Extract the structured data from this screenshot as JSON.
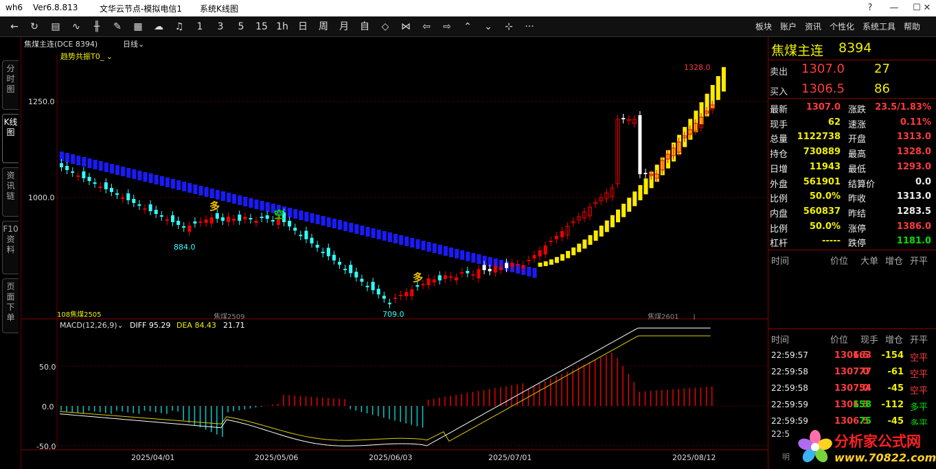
{
  "titlebar": {
    "app": "wh6",
    "version": "Ver6.8.813",
    "server": "文华云节点-模拟电信1",
    "view": "系统K线图"
  },
  "window_buttons": {
    "help": "?",
    "minimize": "—",
    "maximize": "☐",
    "close": "✕"
  },
  "toolbar": {
    "periods": [
      "1",
      "3",
      "5",
      "15",
      "1h",
      "日",
      "周",
      "月",
      "自"
    ],
    "menus": [
      "板块",
      "账户",
      "资讯",
      "个性化",
      "系统工具",
      "帮助"
    ],
    "more": "···"
  },
  "side_tabs": [
    "分时图",
    "K线图",
    "资讯链",
    "F10资料",
    "页面下单"
  ],
  "chart_header": {
    "symbol": "焦煤主连(DCE 8394)",
    "period": "日线",
    "indicator": "趋势共振T0_"
  },
  "price_axis": {
    "labels": [
      "1250.0",
      "1000.0"
    ]
  },
  "annotations": {
    "high": "1328.0",
    "low1": "884.0",
    "low2": "709.0",
    "contract1": "焦煤2509",
    "contract2": "焦煤2601",
    "contract0": "108焦煤2505",
    "duo": "多",
    "kong": "空"
  },
  "macd": {
    "title": "MACD(12,26,9)",
    "diff": "DIFF 95.29",
    "dea": "DEA 84.43",
    "macd": "21.71",
    "axis": [
      "50.0",
      "0.0",
      "-50.0"
    ]
  },
  "dates": [
    "2025/04/01",
    "2025/05/06",
    "2025/06/03",
    "2025/07/01",
    "2025/08/12"
  ],
  "quote": {
    "name": "焦煤主连",
    "code": "8394",
    "sell": {
      "label": "卖出",
      "price": "1307.0",
      "vol": "27"
    },
    "buy": {
      "label": "买入",
      "price": "1306.5",
      "vol": "86"
    },
    "rows": [
      [
        "最新",
        "1307.0",
        "涨跌",
        "23.5/1.83%"
      ],
      [
        "现手",
        "62",
        "速涨",
        "0.11%"
      ],
      [
        "总量",
        "1122738",
        "开盘",
        "1313.0"
      ],
      [
        "持仓",
        "730889",
        "最高",
        "1328.0"
      ],
      [
        "日增",
        "11943",
        "最低",
        "1293.0"
      ],
      [
        "外盘",
        "561901",
        "结算价",
        "0.0"
      ],
      [
        "比例",
        "50.0%",
        "昨收",
        "1313.0"
      ],
      [
        "内盘",
        "560837",
        "昨结",
        "1283.5"
      ],
      [
        "比例",
        "50.0%",
        "涨停",
        "1386.0"
      ],
      [
        "杠杆",
        "-----",
        "跌停",
        "1181.0"
      ]
    ],
    "bigorder_head": [
      "时间",
      "价位",
      "大单",
      "增仓",
      "开平"
    ],
    "tick_head": [
      "时间",
      "价位",
      "现手",
      "增仓",
      "开平"
    ],
    "ticks": [
      [
        "22:59:57",
        "1306.5",
        "163",
        "-154",
        "空平"
      ],
      [
        "22:59:58",
        "1307.0",
        "77",
        "-61",
        "空平"
      ],
      [
        "22:59:58",
        "1307.0",
        "54",
        "-45",
        "空平"
      ],
      [
        "22:59:59",
        "1306.5",
        "158",
        "-112",
        "多平"
      ],
      [
        "22:59:59",
        "1306.5",
        "75",
        "-45",
        "多平"
      ]
    ],
    "tick_partial": "22:5",
    "tab_partial": "明"
  },
  "logo": {
    "name": "分析家公式网",
    "url": "www.70822.com"
  }
}
